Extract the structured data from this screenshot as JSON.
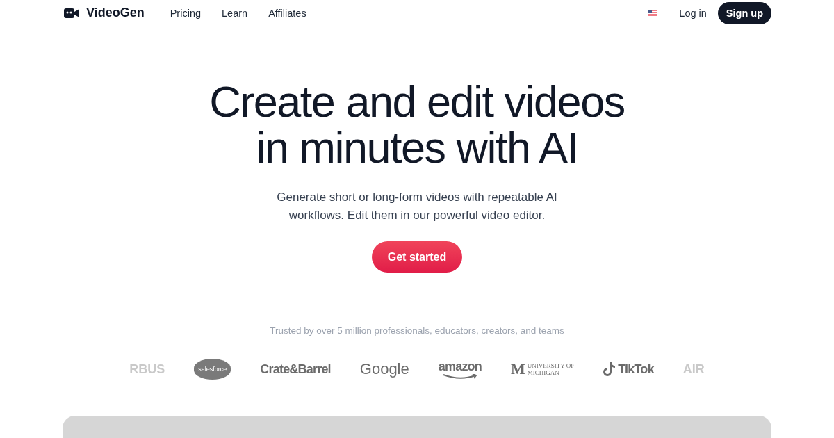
{
  "nav": {
    "brand": "VideoGen",
    "links": [
      "Pricing",
      "Learn",
      "Affiliates"
    ],
    "login": "Log in",
    "signup": "Sign up"
  },
  "hero": {
    "title_lines": [
      "Create and edit videos",
      "in minutes with AI"
    ],
    "subtitle_lines": [
      "Generate short or long-form videos with repeatable AI",
      "workflows. Edit them in our powerful video editor."
    ],
    "cta": "Get started"
  },
  "trusted": {
    "caption": "Trusted by over 5 million professionals, educators, creators, and teams",
    "logos": [
      {
        "kind": "faded",
        "text": "RBUS"
      },
      {
        "kind": "cloud",
        "text": "salesforce"
      },
      {
        "kind": "word",
        "text": "Crate&Barrel"
      },
      {
        "kind": "light",
        "text": "Google"
      },
      {
        "kind": "amazon",
        "text": "amazon"
      },
      {
        "kind": "michigan",
        "mark": "M",
        "lines": [
          "UNIVERSITY OF",
          "MICHIGAN"
        ]
      },
      {
        "kind": "tiktok",
        "text": "TikTok"
      },
      {
        "kind": "faded",
        "text": "AIR"
      }
    ]
  }
}
